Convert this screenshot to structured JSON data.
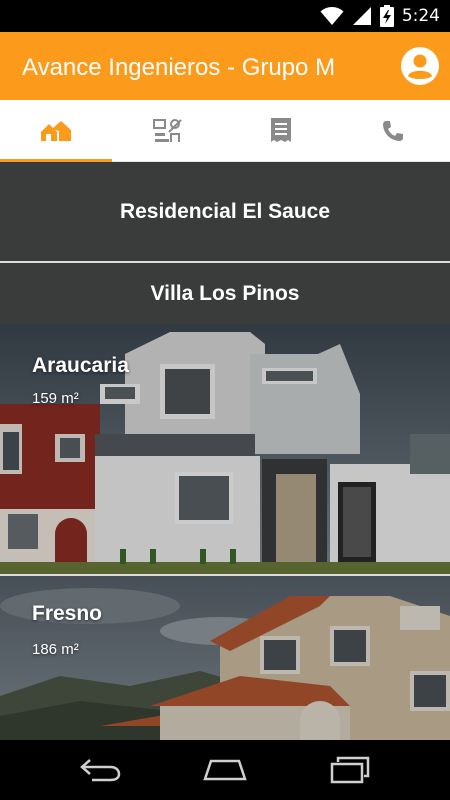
{
  "status_bar": {
    "time": "5:24"
  },
  "app_bar": {
    "title": "Avance Ingenieros - Grupo M"
  },
  "tabs": [
    {
      "icon": "home-icon",
      "active": true
    },
    {
      "icon": "plans-icon",
      "active": false
    },
    {
      "icon": "document-icon",
      "active": false
    },
    {
      "icon": "phone-icon",
      "active": false
    }
  ],
  "sections": [
    {
      "label": "Residencial El Sauce"
    },
    {
      "label": "Villa Los Pinos"
    }
  ],
  "cards": [
    {
      "name": "Araucaria",
      "area": "159 m²"
    },
    {
      "name": "Fresno",
      "area": "186 m²"
    }
  ],
  "colors": {
    "accent": "#fb9a1b",
    "row_bg": "#3a3b3b",
    "inactive_icon": "#8a8a8a"
  },
  "nav": [
    "back-icon",
    "home-icon",
    "recents-icon"
  ]
}
